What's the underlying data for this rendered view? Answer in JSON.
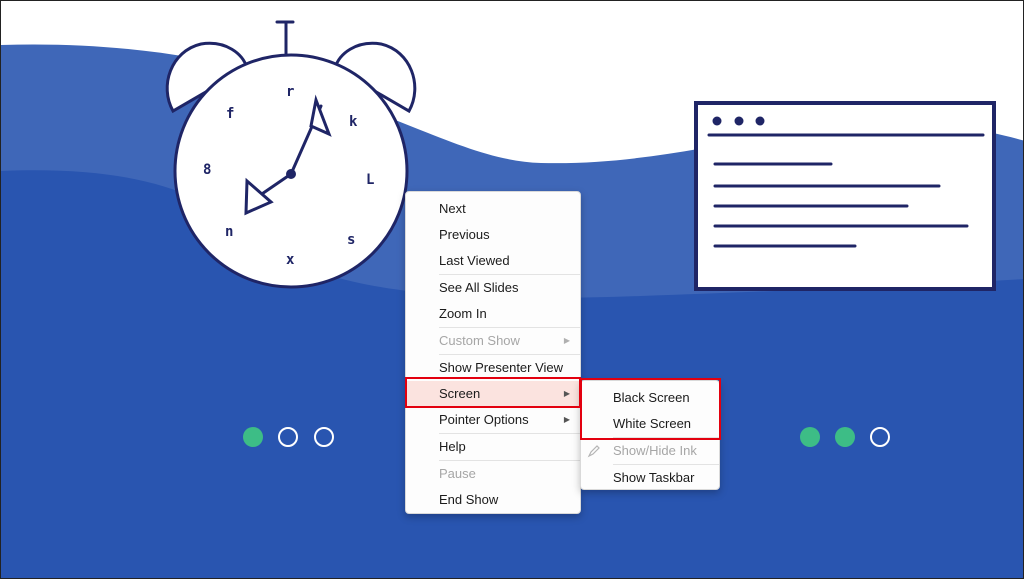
{
  "context_menu": {
    "items": [
      {
        "label": "Next",
        "disabled": false,
        "submenu": false
      },
      {
        "label": "Previous",
        "disabled": false,
        "submenu": false
      },
      {
        "label": "Last Viewed",
        "disabled": false,
        "submenu": false
      },
      {
        "label": "See All Slides",
        "disabled": false,
        "submenu": false
      },
      {
        "label": "Zoom In",
        "disabled": false,
        "submenu": false
      },
      {
        "label": "Custom Show",
        "disabled": true,
        "submenu": true
      },
      {
        "label": "Show Presenter View",
        "disabled": false,
        "submenu": false
      },
      {
        "label": "Screen",
        "disabled": false,
        "submenu": true,
        "highlighted": true
      },
      {
        "label": "Pointer Options",
        "disabled": false,
        "submenu": true
      },
      {
        "label": "Help",
        "disabled": false,
        "submenu": false
      },
      {
        "label": "Pause",
        "disabled": true,
        "submenu": false
      },
      {
        "label": "End Show",
        "disabled": false,
        "submenu": false
      }
    ]
  },
  "screen_submenu": {
    "items": [
      {
        "label": "Black Screen",
        "disabled": false
      },
      {
        "label": "White Screen",
        "disabled": false
      },
      {
        "label": "Show/Hide Ink",
        "disabled": true,
        "icon": "pen-icon"
      },
      {
        "label": "Show Taskbar",
        "disabled": false
      }
    ]
  },
  "slide": {
    "left_dots": [
      "filled",
      "outline",
      "outline"
    ],
    "right_dots": [
      "filled",
      "filled",
      "outline"
    ]
  },
  "colors": {
    "wave_light": "#3f67b8",
    "wave_dark": "#2955b0",
    "dot_green": "#3dbd86",
    "ink_navy": "#1f2566",
    "highlight_red": "#e3000f"
  }
}
